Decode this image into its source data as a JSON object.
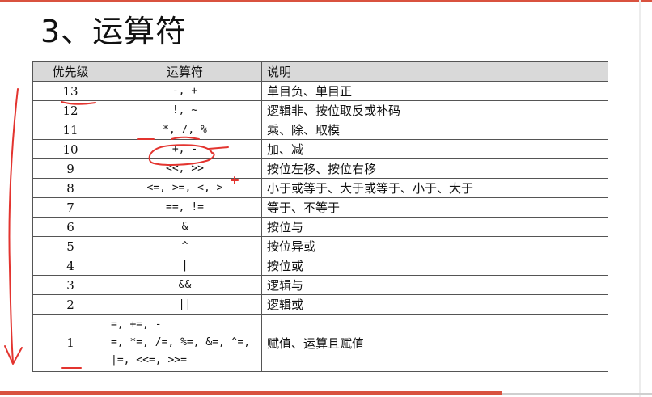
{
  "slide": {
    "title": "3、运算符"
  },
  "table": {
    "headers": [
      "优先级",
      "运算符",
      "说明"
    ],
    "rows": [
      {
        "level": "13",
        "ops": "-, +",
        "desc": "单目负、单目正"
      },
      {
        "level": "12",
        "ops": "!, ~",
        "desc": "逻辑非、按位取反或补码"
      },
      {
        "level": "11",
        "ops": "*, /, %",
        "desc": "乘、除、取模"
      },
      {
        "level": "10",
        "ops": "+, -",
        "desc": "加、减"
      },
      {
        "level": "9",
        "ops": "<<, >>",
        "desc": "按位左移、按位右移"
      },
      {
        "level": "8",
        "ops": "<=, >=, <, >",
        "desc": "小于或等于、大于或等于、小于、大于"
      },
      {
        "level": "7",
        "ops": "==, !=",
        "desc": "等于、不等于"
      },
      {
        "level": "6",
        "ops": "&",
        "desc": "按位与"
      },
      {
        "level": "5",
        "ops": "^",
        "desc": "按位异或"
      },
      {
        "level": "4",
        "ops": "|",
        "desc": "按位或"
      },
      {
        "level": "3",
        "ops": "&&",
        "desc": "逻辑与"
      },
      {
        "level": "2",
        "ops": "||",
        "desc": "逻辑或"
      },
      {
        "level": "1",
        "ops_lines": [
          "=, +=, -",
          "=, *=, /=, %=, &=, ^=,",
          "|=, <<=, >>="
        ],
        "desc": "赋值、运算且赋值"
      }
    ]
  },
  "annotation_color": "#e3342f"
}
